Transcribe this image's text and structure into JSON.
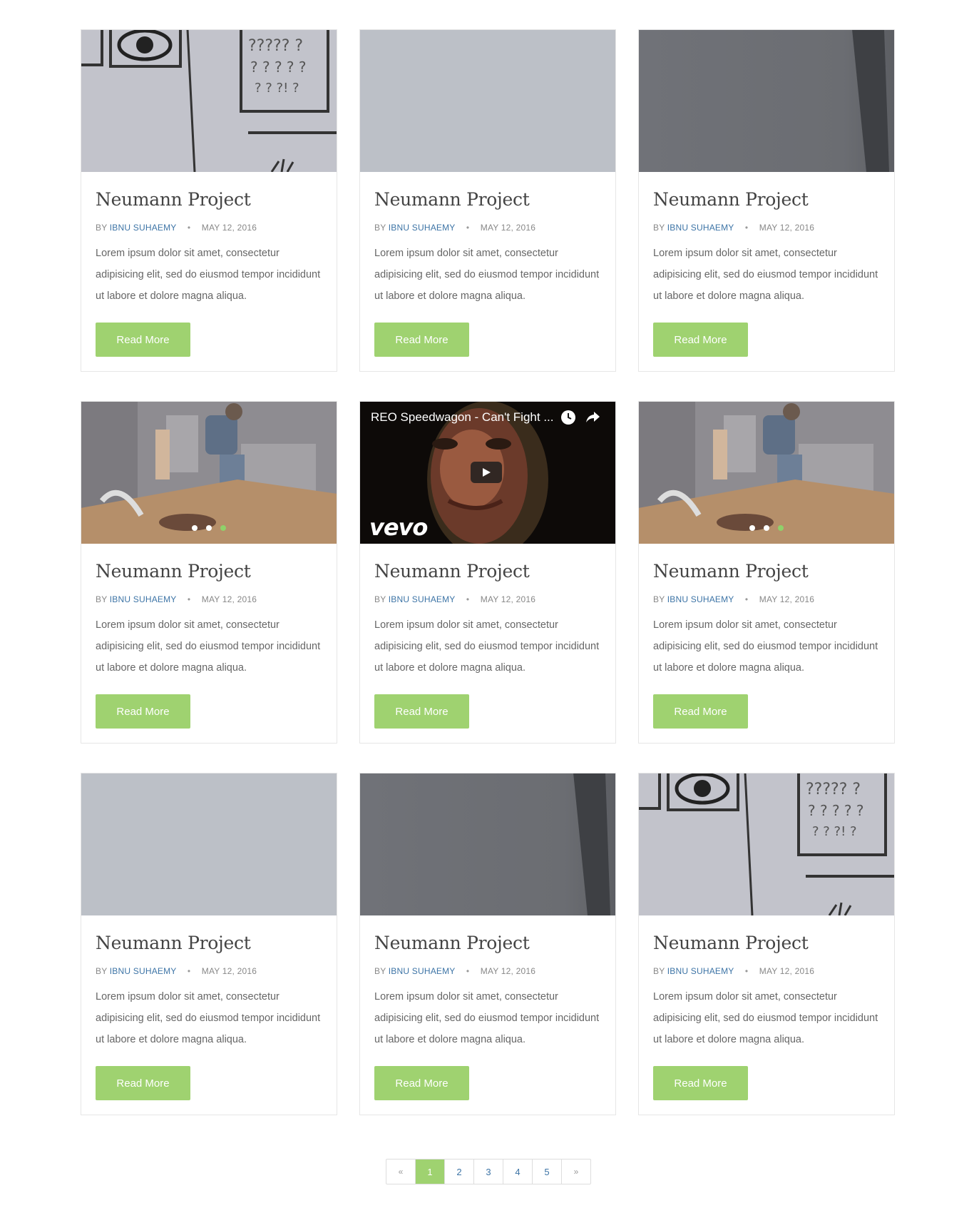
{
  "cards": [
    {
      "media": "eye-chart",
      "title": "Neumann Project",
      "by": "BY",
      "author": "IBNU SUHAEMY",
      "date": "MAY 12, 2016",
      "excerpt": "Lorem ipsum dolor sit amet, consectetur adipisicing elit, sed do eiusmod tempor incididunt ut labore et dolore magna aliqua.",
      "button": "Read More"
    },
    {
      "media": "plain-wall",
      "title": "Neumann Project",
      "by": "BY",
      "author": "IBNU SUHAEMY",
      "date": "MAY 12, 2016",
      "excerpt": "Lorem ipsum dolor sit amet, consectetur adipisicing elit, sed do eiusmod tempor incididunt ut labore et dolore magna aliqua.",
      "button": "Read More"
    },
    {
      "media": "dark-wall",
      "title": "Neumann Project",
      "by": "BY",
      "author": "IBNU SUHAEMY",
      "date": "MAY 12, 2016",
      "excerpt": "Lorem ipsum dolor sit amet, consectetur adipisicing elit, sed do eiusmod tempor incididunt ut labore et dolore magna aliqua.",
      "button": "Read More"
    },
    {
      "media": "office-slider",
      "title": "Neumann Project",
      "by": "BY",
      "author": "IBNU SUHAEMY",
      "date": "MAY 12, 2016",
      "excerpt": "Lorem ipsum dolor sit amet, consectetur adipisicing elit, sed do eiusmod tempor incididunt ut labore et dolore magna aliqua.",
      "button": "Read More"
    },
    {
      "media": "video",
      "title": "Neumann Project",
      "by": "BY",
      "author": "IBNU SUHAEMY",
      "date": "MAY 12, 2016",
      "excerpt": "Lorem ipsum dolor sit amet, consectetur adipisicing elit, sed do eiusmod tempor incididunt ut labore et dolore magna aliqua.",
      "button": "Read More"
    },
    {
      "media": "office-slider",
      "title": "Neumann Project",
      "by": "BY",
      "author": "IBNU SUHAEMY",
      "date": "MAY 12, 2016",
      "excerpt": "Lorem ipsum dolor sit amet, consectetur adipisicing elit, sed do eiusmod tempor incididunt ut labore et dolore magna aliqua.",
      "button": "Read More"
    },
    {
      "media": "plain-wall",
      "title": "Neumann Project",
      "by": "BY",
      "author": "IBNU SUHAEMY",
      "date": "MAY 12, 2016",
      "excerpt": "Lorem ipsum dolor sit amet, consectetur adipisicing elit, sed do eiusmod tempor incididunt ut labore et dolore magna aliqua.",
      "button": "Read More"
    },
    {
      "media": "dark-wall",
      "title": "Neumann Project",
      "by": "BY",
      "author": "IBNU SUHAEMY",
      "date": "MAY 12, 2016",
      "excerpt": "Lorem ipsum dolor sit amet, consectetur adipisicing elit, sed do eiusmod tempor incididunt ut labore et dolore magna aliqua.",
      "button": "Read More"
    },
    {
      "media": "eye-chart",
      "title": "Neumann Project",
      "by": "BY",
      "author": "IBNU SUHAEMY",
      "date": "MAY 12, 2016",
      "excerpt": "Lorem ipsum dolor sit amet, consectetur adipisicing elit, sed do eiusmod tempor incididunt ut labore et dolore magna aliqua.",
      "button": "Read More"
    }
  ],
  "video": {
    "title": "REO Speedwagon - Can't Fight ...",
    "logo": "vevo",
    "icons": [
      "clock-icon",
      "share-icon",
      "play-icon"
    ]
  },
  "slider": {
    "dot_count": 3,
    "active_index": 2
  },
  "pagination": {
    "prev": "«",
    "pages": [
      "1",
      "2",
      "3",
      "4",
      "5"
    ],
    "next": "»",
    "active": "1"
  },
  "colors": {
    "accent": "#9fd270",
    "link": "#3d74a6",
    "border": "#e6e6e6"
  }
}
